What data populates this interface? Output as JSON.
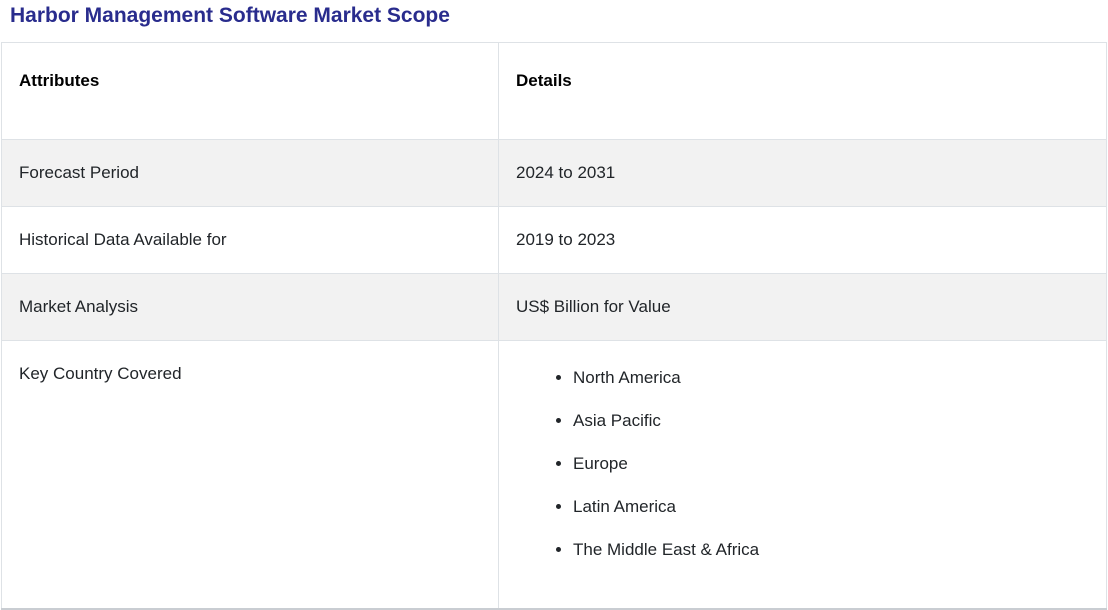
{
  "page": {
    "title": "Harbor Management Software Market Scope"
  },
  "colors": {
    "title_text": "#292C8D",
    "header_text": "#000000",
    "body_text": "#212529",
    "row_alt_bg": "#F2F2F2",
    "row_bg": "#FFFFFF",
    "border": "#DEE2E6",
    "table_bottom_border": "#C9CDD2"
  },
  "table": {
    "columns": [
      {
        "label": "Attributes"
      },
      {
        "label": "Details"
      }
    ],
    "rows": [
      {
        "attribute": "Forecast Period",
        "detail": "2024 to 2031"
      },
      {
        "attribute": "Historical Data Available for",
        "detail": "2019 to 2023"
      },
      {
        "attribute": "Market Analysis",
        "detail": "US$ Billion for Value"
      },
      {
        "attribute": "Key Country Covered",
        "details": [
          "North America",
          "Asia Pacific",
          "Europe",
          "Latin America",
          "The Middle East & Africa"
        ]
      }
    ]
  }
}
